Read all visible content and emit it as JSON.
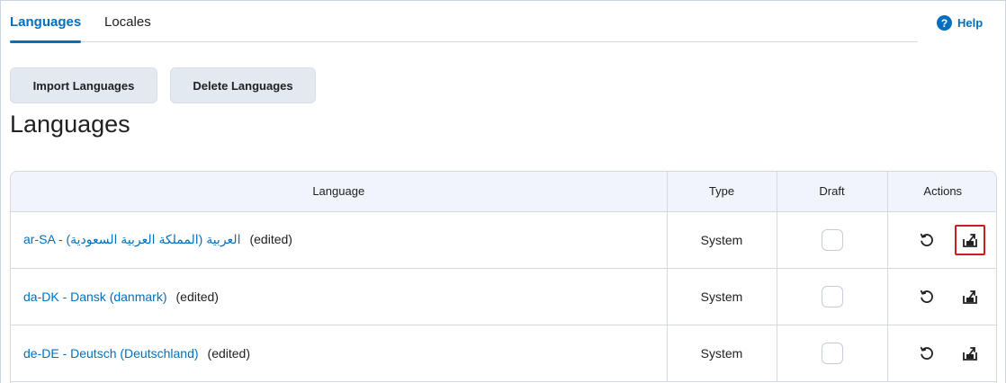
{
  "tabs": [
    {
      "label": "Languages",
      "active": true
    },
    {
      "label": "Locales",
      "active": false
    }
  ],
  "help": {
    "icon": "?",
    "label": "Help"
  },
  "toolbar": {
    "import_label": "Import Languages",
    "delete_label": "Delete Languages"
  },
  "page_title": "Languages",
  "table": {
    "columns": [
      "Language",
      "Type",
      "Draft",
      "Actions"
    ],
    "rows": [
      {
        "language": "ar-SA - العربية (المملكة العربية السعودية)",
        "status": "(edited)",
        "type": "System",
        "draft": false,
        "export_focused": true
      },
      {
        "language": "da-DK - Dansk (danmark)",
        "status": "(edited)",
        "type": "System",
        "draft": false,
        "export_focused": false
      },
      {
        "language": "de-DE - Deutsch (Deutschland)",
        "status": "(edited)",
        "type": "System",
        "draft": false,
        "export_focused": false
      }
    ]
  },
  "colors": {
    "accent": "#006fbf",
    "focus_outline": "#c81e1e"
  },
  "icons": {
    "revert": "revert-icon",
    "export": "export-icon"
  }
}
